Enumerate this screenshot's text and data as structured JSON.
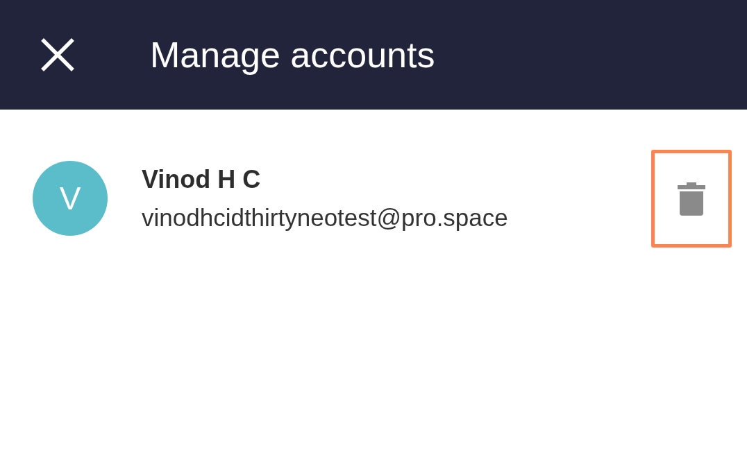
{
  "app_bar": {
    "title": "Manage accounts"
  },
  "accounts": [
    {
      "initial": "V",
      "color": "#5bbdc9",
      "name": "Vinod H C",
      "email": "vinodhcidthirtyneotest@pro.space",
      "delete_highlighted": true
    }
  ]
}
